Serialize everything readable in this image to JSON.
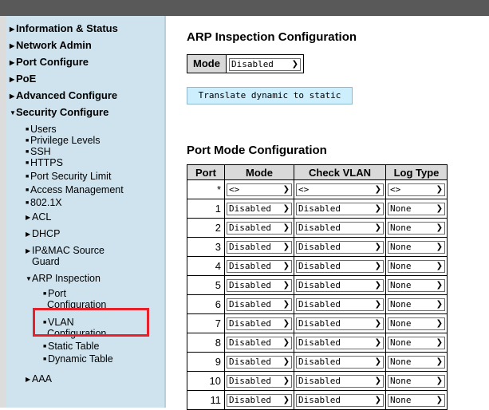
{
  "sidebar": {
    "items": [
      {
        "label": "Information & Status",
        "expanded": false
      },
      {
        "label": "Network Admin",
        "expanded": false
      },
      {
        "label": "Port Configure",
        "expanded": false
      },
      {
        "label": "PoE",
        "expanded": false
      },
      {
        "label": "Advanced Configure",
        "expanded": false
      },
      {
        "label": "Security Configure",
        "expanded": true
      }
    ],
    "security_items": [
      "Users",
      "Privilege Levels",
      "SSH",
      "HTTPS",
      "Port Security Limit",
      "Access Management",
      "802.1X"
    ],
    "security_groups": [
      "ACL",
      "DHCP"
    ],
    "ipmac_line1": "IP&MAC Source",
    "ipmac_line2": "Guard",
    "arp": "ARP Inspection",
    "port_line1": "Port",
    "port_line2": "Configuration",
    "vlan_line1": "VLAN",
    "vlan_line2": "Configuration",
    "static_table": "Static Table",
    "dynamic_table": "Dynamic Table",
    "aaa": "AAA"
  },
  "page": {
    "title": "ARP Inspection Configuration",
    "mode_label": "Mode",
    "mode_value": "Disabled",
    "translate_button": "Translate dynamic to static",
    "port_mode_title": "Port Mode Configuration"
  },
  "table": {
    "headers": [
      "Port",
      "Mode",
      "Check VLAN",
      "Log Type"
    ],
    "rows": [
      {
        "port": "*",
        "mode": "<>",
        "check_vlan": "<>",
        "log_type": "<>"
      },
      {
        "port": "1",
        "mode": "Disabled",
        "check_vlan": "Disabled",
        "log_type": "None"
      },
      {
        "port": "2",
        "mode": "Disabled",
        "check_vlan": "Disabled",
        "log_type": "None"
      },
      {
        "port": "3",
        "mode": "Disabled",
        "check_vlan": "Disabled",
        "log_type": "None"
      },
      {
        "port": "4",
        "mode": "Disabled",
        "check_vlan": "Disabled",
        "log_type": "None"
      },
      {
        "port": "5",
        "mode": "Disabled",
        "check_vlan": "Disabled",
        "log_type": "None"
      },
      {
        "port": "6",
        "mode": "Disabled",
        "check_vlan": "Disabled",
        "log_type": "None"
      },
      {
        "port": "7",
        "mode": "Disabled",
        "check_vlan": "Disabled",
        "log_type": "None"
      },
      {
        "port": "8",
        "mode": "Disabled",
        "check_vlan": "Disabled",
        "log_type": "None"
      },
      {
        "port": "9",
        "mode": "Disabled",
        "check_vlan": "Disabled",
        "log_type": "None"
      },
      {
        "port": "10",
        "mode": "Disabled",
        "check_vlan": "Disabled",
        "log_type": "None"
      },
      {
        "port": "11",
        "mode": "Disabled",
        "check_vlan": "Disabled",
        "log_type": "None"
      }
    ]
  },
  "colors": {
    "sidebar_bg": "#cfe3ee",
    "highlight": "#e8202a",
    "header_bg": "#d9d9d9",
    "button_bg": "#cdeefc"
  },
  "icons": {
    "collapsed": "triangle-right-icon",
    "expanded": "triangle-down-icon",
    "bullet": "square-bullet-icon",
    "dropdown": "chevron-down-icon"
  }
}
